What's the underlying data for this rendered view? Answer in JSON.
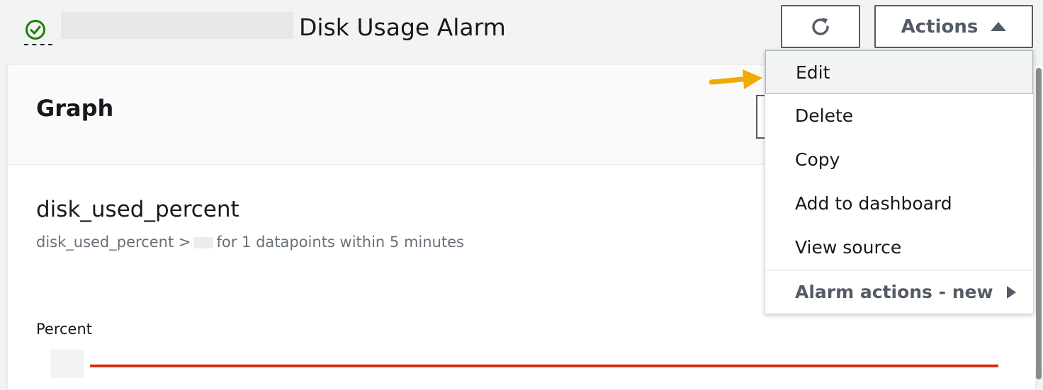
{
  "header": {
    "alarm_title": "Disk Usage Alarm",
    "status_icon": "check-circle-icon",
    "actions_label": "Actions",
    "refresh_icon": "refresh-icon"
  },
  "panel": {
    "title": "Graph",
    "metric_name": "disk_used_percent",
    "metric_desc_prefix": "disk_used_percent >",
    "metric_desc_suffix": "for 1 datapoints within 5 minutes",
    "y_axis_label": "Percent"
  },
  "menu": {
    "items": [
      {
        "label": "Edit"
      },
      {
        "label": "Delete"
      },
      {
        "label": "Copy"
      },
      {
        "label": "Add to dashboard"
      },
      {
        "label": "View source"
      }
    ],
    "submenu_label": "Alarm actions - new"
  },
  "colors": {
    "ok_green": "#1d8102",
    "threshold_red": "#d13212",
    "pointer_orange": "#f2a900"
  }
}
